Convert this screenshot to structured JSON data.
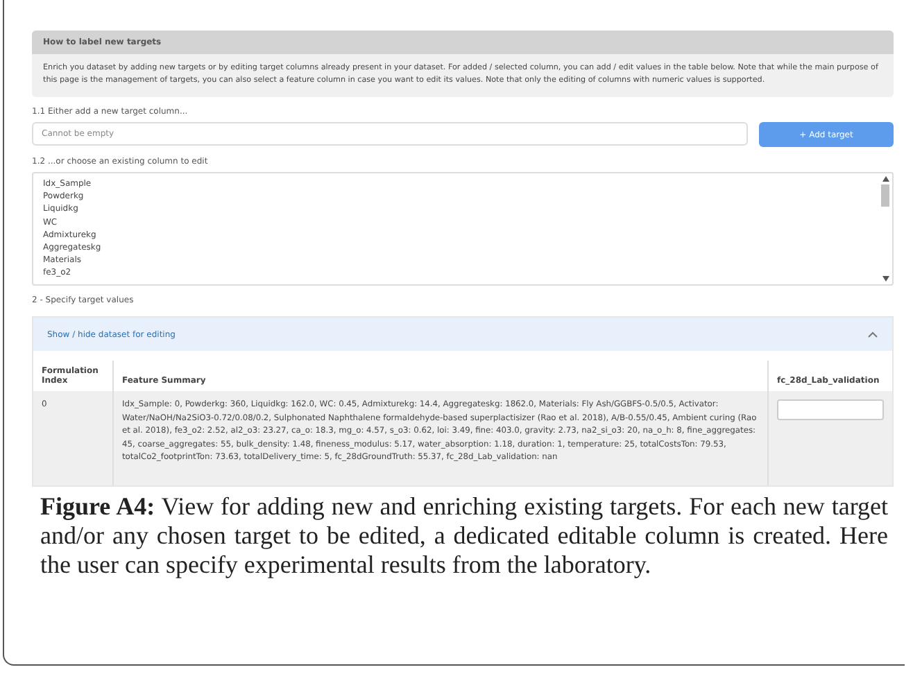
{
  "info_box": {
    "title": "How to label new targets",
    "text": "Enrich you dataset by adding new targets or by editing target columns already present in your dataset. For added / selected column, you can add / edit values in the table below. Note that while the main purpose of this page is the management of targets, you can also select a feature column in case you want to edit its values. Note that only the editing of columns with numeric values is supported."
  },
  "new_target": {
    "label": "1.1 Either add a new target column...",
    "placeholder": "Cannot be empty",
    "button": "+ Add target"
  },
  "existing_column": {
    "label": "1.2 ...or choose an existing column to edit",
    "options": [
      "Idx_Sample",
      "Powderkg",
      "Liquidkg",
      "WC",
      "Admixturekg",
      "Aggregateskg",
      "Materials",
      "fe3_o2"
    ]
  },
  "section_label": "2 - Specify target values",
  "accordion": {
    "title": "Show / hide dataset for editing",
    "expanded": true
  },
  "table": {
    "columns": [
      "Formulation Index",
      "Feature Summary",
      "fc_28d_Lab_validation"
    ],
    "rows": [
      {
        "index": "0",
        "summary": "Idx_Sample: 0, Powderkg: 360, Liquidkg: 162.0, WC: 0.45, Admixturekg: 14.4, Aggregateskg: 1862.0, Materials: Fly Ash/GGBFS-0.5/0.5, Activator: Water/NaOH/Na2SiO3-0.72/0.08/0.2, Sulphonated Naphthalene formaldehyde-based superplactisizer (Rao et al. 2018), A/B-0.55/0.45, Ambient curing (Rao et al. 2018), fe3_o2: 2.52, al2_o3: 23.27, ca_o: 18.3, mg_o: 4.57, s_o3: 0.62, loi: 3.49, fine: 403.0, gravity: 2.73, na2_si_o3: 20, na_o_h: 8, fine_aggregates: 45, coarse_aggregates: 55, bulk_density: 1.48, fineness_modulus: 5.17, water_absorption: 1.18, duration: 1, temperature: 25, totalCostsTon: 79.53, totalCo2_footprintTon: 73.63, totalDelivery_time: 5, fc_28dGroundTruth: 55.37, fc_28d_Lab_validation: nan"
      }
    ]
  },
  "caption": "**Figure A4:** View for adding new and enriching existing targets. For each new target and/or any chosen target to be edited, a dedicated editable column is created. Here the user can specify experimental results from the laboratory."
}
